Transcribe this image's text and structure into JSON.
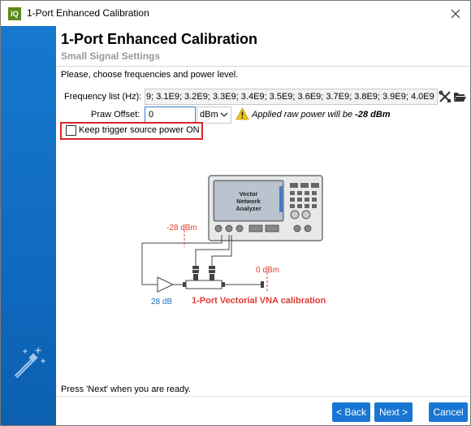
{
  "window": {
    "app_icon_text": "IQ",
    "title": "1-Port Enhanced Calibration"
  },
  "header": {
    "title": "1-Port Enhanced Calibration",
    "subtitle": "Small Signal Settings"
  },
  "instruction": "Please, choose frequencies and power level.",
  "frequency": {
    "label": "Frequency list (Hz):",
    "value": "9; 3.1E9; 3.2E9; 3.3E9; 3.4E9; 3.5E9; 3.6E9; 3.7E9; 3.8E9; 3.9E9; 4.0E9"
  },
  "praw": {
    "label": "Praw Offset:",
    "value": "0",
    "unit": "dBm",
    "applied_prefix": "Applied raw power will be ",
    "applied_value": "-28 dBm"
  },
  "keep_trigger": {
    "label": "Keep trigger source power ON",
    "checked": false
  },
  "diagram": {
    "vna_line1": "Vector",
    "vna_line2": "Network",
    "vna_line3": "Analyzer",
    "power_left": "-28 dBm",
    "power_right": "0 dBm",
    "gain": "28 dB",
    "caption": "1-Port Vectorial VNA calibration"
  },
  "footer": {
    "ready_text": "Press 'Next' when you are ready.",
    "back_label": "< Back",
    "next_label": "Next >",
    "cancel_label": "Cancel"
  },
  "colors": {
    "accent": "#1976d2",
    "sidebar": "#1470c8",
    "highlight": "#d9262b",
    "power": "#e03a2f",
    "gain": "#1f6fbf"
  }
}
